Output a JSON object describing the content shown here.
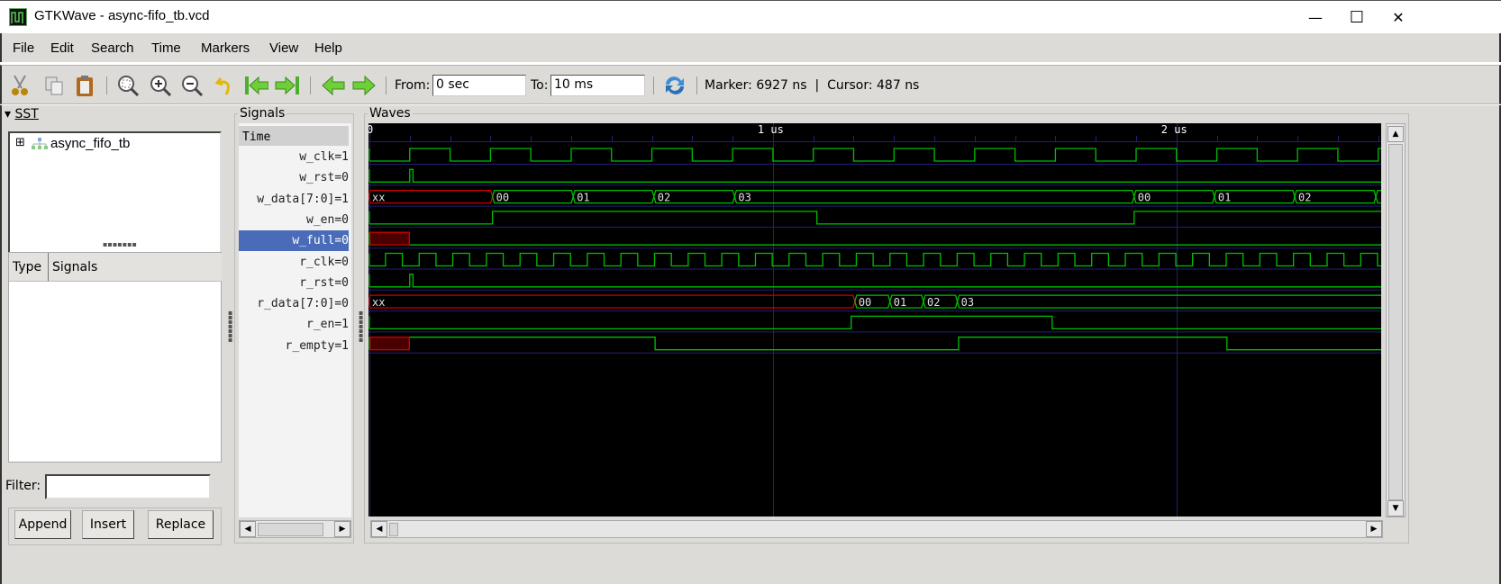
{
  "window": {
    "title": "GTKWave - async-fifo_tb.vcd",
    "minimize": "—",
    "maximize": "☐",
    "close": "✕"
  },
  "menu": [
    "File",
    "Edit",
    "Search",
    "Time",
    "Markers",
    "View",
    "Help"
  ],
  "toolbar": {
    "icons": [
      "cut-icon",
      "copy-icon",
      "paste-icon",
      "zoom-fit-icon",
      "zoom-in-icon",
      "zoom-out-icon",
      "undo-zoom-icon",
      "jump-start-icon",
      "jump-end-icon",
      "prev-edge-icon",
      "next-edge-icon",
      "reload-icon"
    ],
    "from_label": "From:",
    "from_value": "0 sec",
    "to_label": "To:",
    "to_value": "10 ms",
    "marker_text": "Marker: 6927 ns  |  Cursor: 487 ns"
  },
  "sst": {
    "title": "SST",
    "tree": [
      {
        "label": "async_fifo_tb",
        "expander": "⊞"
      }
    ],
    "columns": [
      "Type",
      "Signals"
    ],
    "filter_label": "Filter:",
    "filter_value": "",
    "buttons": [
      "Append",
      "Insert",
      "Replace"
    ]
  },
  "signals_panel": {
    "title": "Signals",
    "time_header": "Time",
    "selected_index": 4,
    "names": [
      "w_clk=1",
      "w_rst=0",
      "w_data[7:0]=1",
      "w_en=0",
      "w_full=0",
      "r_clk=0",
      "r_rst=0",
      "r_data[7:0]=0",
      "r_en=1",
      "r_empty=1"
    ]
  },
  "waves_panel": {
    "title": "Waves",
    "time_labels": [
      {
        "t_ns": 0,
        "label": "0"
      },
      {
        "t_ns": 1000,
        "label": "1 us"
      },
      {
        "t_ns": 2000,
        "label": "2 us"
      }
    ],
    "view_start_ns": 0,
    "view_end_ns": 2505,
    "minor_tick_ns": 100,
    "colors": {
      "wave": "#00c000",
      "x": "#d00000",
      "x_fill": "#4a0000",
      "grid": "#202078",
      "text": "#e0e0e0",
      "bg": "#000000"
    },
    "signals": [
      {
        "name": "w_clk",
        "kind": "clock",
        "period_ns": 200,
        "first_rise_ns": 100,
        "initial": 0
      },
      {
        "name": "w_rst",
        "kind": "bit",
        "changes": [
          [
            0,
            "0"
          ],
          [
            100,
            "1"
          ],
          [
            108,
            "0"
          ]
        ]
      },
      {
        "name": "w_data",
        "kind": "bus",
        "changes": [
          [
            0,
            "xx"
          ],
          [
            305,
            "00"
          ],
          [
            505,
            "01"
          ],
          [
            705,
            "02"
          ],
          [
            905,
            "03"
          ],
          [
            1895,
            "00"
          ],
          [
            2094,
            "01"
          ],
          [
            2293,
            "02"
          ],
          [
            2494,
            "03"
          ]
        ]
      },
      {
        "name": "w_en",
        "kind": "bit",
        "changes": [
          [
            0,
            "0"
          ],
          [
            305,
            "1"
          ],
          [
            1109,
            "0"
          ],
          [
            1895,
            "1"
          ]
        ]
      },
      {
        "name": "w_full",
        "kind": "bit",
        "changes": [
          [
            0,
            "x"
          ],
          [
            100,
            "0"
          ]
        ]
      },
      {
        "name": "r_clk",
        "kind": "clock",
        "period_ns": 83.33,
        "first_rise_ns": 40,
        "initial": 0
      },
      {
        "name": "r_rst",
        "kind": "bit",
        "changes": [
          [
            0,
            "0"
          ],
          [
            100,
            "1"
          ],
          [
            108,
            "0"
          ]
        ]
      },
      {
        "name": "r_data",
        "kind": "bus",
        "changes": [
          [
            0,
            "xx"
          ],
          [
            1203,
            "00"
          ],
          [
            1290,
            "01"
          ],
          [
            1373,
            "02"
          ],
          [
            1457,
            "03"
          ]
        ]
      },
      {
        "name": "r_en",
        "kind": "bit",
        "changes": [
          [
            0,
            "0"
          ],
          [
            1194,
            "1"
          ],
          [
            1692,
            "0"
          ]
        ]
      },
      {
        "name": "r_empty",
        "kind": "bit",
        "changes": [
          [
            0,
            "x"
          ],
          [
            100,
            "1"
          ],
          [
            708,
            "0"
          ],
          [
            1460,
            "1"
          ],
          [
            2125,
            "0"
          ]
        ]
      }
    ]
  }
}
